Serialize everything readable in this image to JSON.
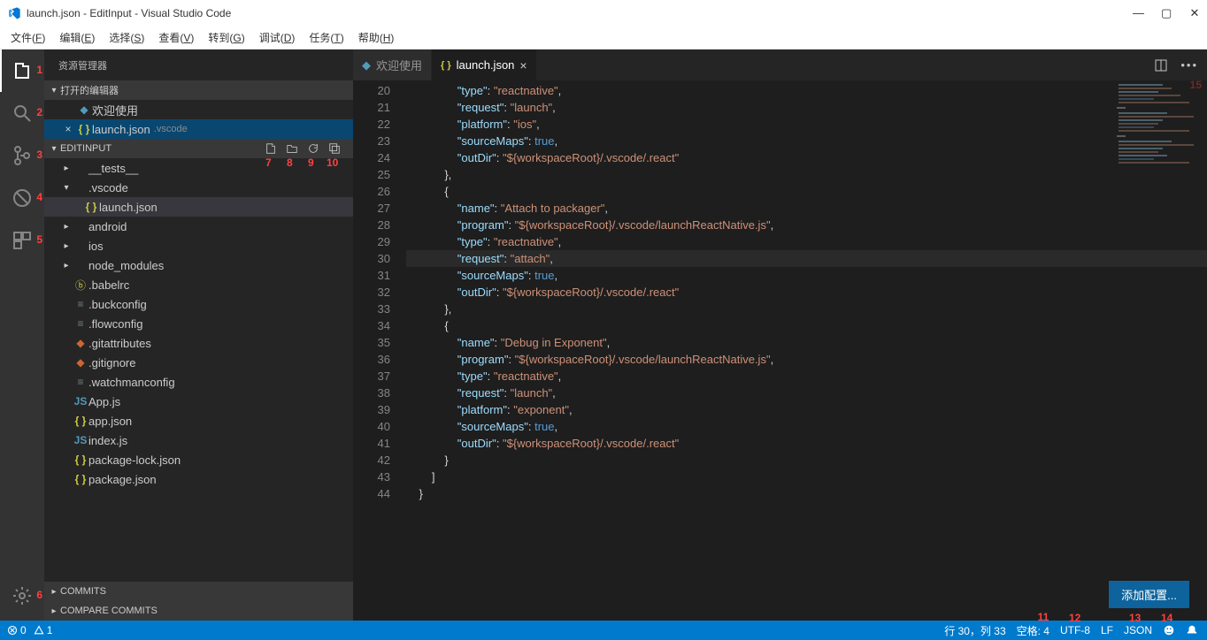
{
  "titlebar": {
    "title": "launch.json - EditInput - Visual Studio Code"
  },
  "menubar": [
    {
      "l": "文件",
      "k": "F"
    },
    {
      "l": "编辑",
      "k": "E"
    },
    {
      "l": "选择",
      "k": "S"
    },
    {
      "l": "查看",
      "k": "V"
    },
    {
      "l": "转到",
      "k": "G"
    },
    {
      "l": "调试",
      "k": "D"
    },
    {
      "l": "任务",
      "k": "T"
    },
    {
      "l": "帮助",
      "k": "H"
    }
  ],
  "activity_nums": [
    "1",
    "2",
    "3",
    "4",
    "5",
    "6"
  ],
  "sidebar": {
    "title": "资源管理器",
    "openEditors": {
      "title": "打开的编辑器",
      "items": [
        {
          "icon": "welcome",
          "label": "欢迎使用"
        },
        {
          "icon": "json",
          "label": "launch.json",
          "desc": ".vscode",
          "selected": true,
          "close": true
        }
      ]
    },
    "project": {
      "title": "EDITINPUT",
      "toolbar_nums": [
        "7",
        "8",
        "9",
        "10"
      ],
      "tree": [
        {
          "ind": 1,
          "chev": "▸",
          "icon": "",
          "label": "__tests__"
        },
        {
          "ind": 1,
          "chev": "▾",
          "icon": "",
          "label": ".vscode"
        },
        {
          "ind": 2,
          "chev": "",
          "icon": "json",
          "label": "launch.json",
          "active": true
        },
        {
          "ind": 1,
          "chev": "▸",
          "icon": "",
          "label": "android"
        },
        {
          "ind": 1,
          "chev": "▸",
          "icon": "",
          "label": "ios"
        },
        {
          "ind": 1,
          "chev": "▸",
          "icon": "",
          "label": "node_modules"
        },
        {
          "ind": 1,
          "chev": "",
          "icon": "babel",
          "label": ".babelrc"
        },
        {
          "ind": 1,
          "chev": "",
          "icon": "cfg",
          "label": ".buckconfig"
        },
        {
          "ind": 1,
          "chev": "",
          "icon": "cfg",
          "label": ".flowconfig"
        },
        {
          "ind": 1,
          "chev": "",
          "icon": "git",
          "label": ".gitattributes"
        },
        {
          "ind": 1,
          "chev": "",
          "icon": "git",
          "label": ".gitignore"
        },
        {
          "ind": 1,
          "chev": "",
          "icon": "cfg",
          "label": ".watchmanconfig"
        },
        {
          "ind": 1,
          "chev": "",
          "icon": "js",
          "label": "App.js"
        },
        {
          "ind": 1,
          "chev": "",
          "icon": "json",
          "label": "app.json"
        },
        {
          "ind": 1,
          "chev": "",
          "icon": "js",
          "label": "index.js"
        },
        {
          "ind": 1,
          "chev": "",
          "icon": "json",
          "label": "package-lock.json"
        },
        {
          "ind": 1,
          "chev": "",
          "icon": "json",
          "label": "package.json"
        }
      ]
    },
    "bottomSections": [
      "COMMITS",
      "COMPARE COMMITS"
    ]
  },
  "tabs": [
    {
      "icon": "welcome",
      "label": "欢迎使用"
    },
    {
      "icon": "json",
      "label": "launch.json",
      "active": true,
      "close": true
    }
  ],
  "minimap_num": "15",
  "code_lines": [
    {
      "n": 20,
      "ind": 4,
      "t": [
        [
          "k",
          "\"type\""
        ],
        [
          "p",
          ": "
        ],
        [
          "s",
          "\"reactnative\""
        ],
        [
          "p",
          ","
        ]
      ]
    },
    {
      "n": 21,
      "ind": 4,
      "t": [
        [
          "k",
          "\"request\""
        ],
        [
          "p",
          ": "
        ],
        [
          "s",
          "\"launch\""
        ],
        [
          "p",
          ","
        ]
      ]
    },
    {
      "n": 22,
      "ind": 4,
      "t": [
        [
          "k",
          "\"platform\""
        ],
        [
          "p",
          ": "
        ],
        [
          "s",
          "\"ios\""
        ],
        [
          "p",
          ","
        ]
      ]
    },
    {
      "n": 23,
      "ind": 4,
      "t": [
        [
          "k",
          "\"sourceMaps\""
        ],
        [
          "p",
          ": "
        ],
        [
          "b",
          "true"
        ],
        [
          "p",
          ","
        ]
      ]
    },
    {
      "n": 24,
      "ind": 4,
      "t": [
        [
          "k",
          "\"outDir\""
        ],
        [
          "p",
          ": "
        ],
        [
          "s",
          "\"${workspaceRoot}/.vscode/.react\""
        ]
      ]
    },
    {
      "n": 25,
      "ind": 3,
      "t": [
        [
          "p",
          "},"
        ]
      ]
    },
    {
      "n": 26,
      "ind": 3,
      "t": [
        [
          "p",
          "{"
        ]
      ]
    },
    {
      "n": 27,
      "ind": 4,
      "t": [
        [
          "k",
          "\"name\""
        ],
        [
          "p",
          ": "
        ],
        [
          "s",
          "\"Attach to packager\""
        ],
        [
          "p",
          ","
        ]
      ]
    },
    {
      "n": 28,
      "ind": 4,
      "t": [
        [
          "k",
          "\"program\""
        ],
        [
          "p",
          ": "
        ],
        [
          "s",
          "\"${workspaceRoot}/.vscode/launchReactNative.js\""
        ],
        [
          "p",
          ","
        ]
      ]
    },
    {
      "n": 29,
      "ind": 4,
      "t": [
        [
          "k",
          "\"type\""
        ],
        [
          "p",
          ": "
        ],
        [
          "s",
          "\"reactnative\""
        ],
        [
          "p",
          ","
        ]
      ]
    },
    {
      "n": 30,
      "ind": 4,
      "hl": true,
      "t": [
        [
          "k",
          "\"request\""
        ],
        [
          "p",
          ": "
        ],
        [
          "s",
          "\"attach\""
        ],
        [
          "p",
          ","
        ]
      ]
    },
    {
      "n": 31,
      "ind": 4,
      "t": [
        [
          "k",
          "\"sourceMaps\""
        ],
        [
          "p",
          ": "
        ],
        [
          "b",
          "true"
        ],
        [
          "p",
          ","
        ]
      ]
    },
    {
      "n": 32,
      "ind": 4,
      "t": [
        [
          "k",
          "\"outDir\""
        ],
        [
          "p",
          ": "
        ],
        [
          "s",
          "\"${workspaceRoot}/.vscode/.react\""
        ]
      ]
    },
    {
      "n": 33,
      "ind": 3,
      "t": [
        [
          "p",
          "},"
        ]
      ]
    },
    {
      "n": 34,
      "ind": 3,
      "t": [
        [
          "p",
          "{"
        ]
      ]
    },
    {
      "n": 35,
      "ind": 4,
      "t": [
        [
          "k",
          "\"name\""
        ],
        [
          "p",
          ": "
        ],
        [
          "s",
          "\"Debug in Exponent\""
        ],
        [
          "p",
          ","
        ]
      ]
    },
    {
      "n": 36,
      "ind": 4,
      "t": [
        [
          "k",
          "\"program\""
        ],
        [
          "p",
          ": "
        ],
        [
          "s",
          "\"${workspaceRoot}/.vscode/launchReactNative.js\""
        ],
        [
          "p",
          ","
        ]
      ]
    },
    {
      "n": 37,
      "ind": 4,
      "t": [
        [
          "k",
          "\"type\""
        ],
        [
          "p",
          ": "
        ],
        [
          "s",
          "\"reactnative\""
        ],
        [
          "p",
          ","
        ]
      ]
    },
    {
      "n": 38,
      "ind": 4,
      "t": [
        [
          "k",
          "\"request\""
        ],
        [
          "p",
          ": "
        ],
        [
          "s",
          "\"launch\""
        ],
        [
          "p",
          ","
        ]
      ]
    },
    {
      "n": 39,
      "ind": 4,
      "t": [
        [
          "k",
          "\"platform\""
        ],
        [
          "p",
          ": "
        ],
        [
          "s",
          "\"exponent\""
        ],
        [
          "p",
          ","
        ]
      ]
    },
    {
      "n": 40,
      "ind": 4,
      "t": [
        [
          "k",
          "\"sourceMaps\""
        ],
        [
          "p",
          ": "
        ],
        [
          "b",
          "true"
        ],
        [
          "p",
          ","
        ]
      ]
    },
    {
      "n": 41,
      "ind": 4,
      "t": [
        [
          "k",
          "\"outDir\""
        ],
        [
          "p",
          ": "
        ],
        [
          "s",
          "\"${workspaceRoot}/.vscode/.react\""
        ]
      ]
    },
    {
      "n": 42,
      "ind": 3,
      "t": [
        [
          "p",
          "}"
        ]
      ]
    },
    {
      "n": 43,
      "ind": 2,
      "t": [
        [
          "p",
          "]"
        ]
      ]
    },
    {
      "n": 44,
      "ind": 1,
      "t": [
        [
          "p",
          "}"
        ]
      ]
    }
  ],
  "addConfig": "添加配置...",
  "statusbar": {
    "errors": "0",
    "warnings": "1",
    "cursor": "行 30，列 33",
    "spaces": "空格: 4",
    "encoding": "UTF-8",
    "eol": "LF",
    "lang": "JSON",
    "nums": [
      "11",
      "12",
      "13",
      "14"
    ]
  }
}
